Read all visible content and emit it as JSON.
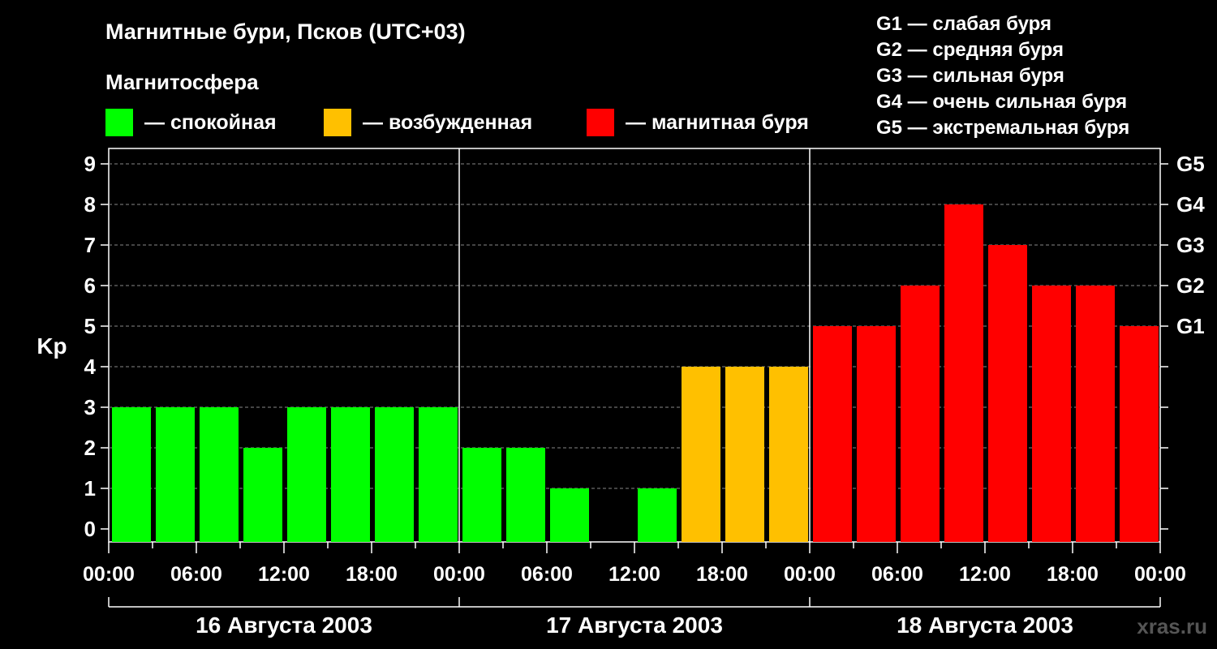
{
  "title": "Магнитные бури, Псков (UTC+03)",
  "subtitle": "Магнитосфера",
  "legend": [
    {
      "label": "— спокойная",
      "color": "#00ff00"
    },
    {
      "label": "— возбужденная",
      "color": "#ffc000"
    },
    {
      "label": "— магнитная буря",
      "color": "#ff0000"
    }
  ],
  "g_legend": [
    "G1 — слабая буря",
    "G2 — средняя буря",
    "G3 — сильная буря",
    "G4 — очень сильная буря",
    "G5 — экстремальная буря"
  ],
  "watermark": "xras.ru",
  "chart_data": {
    "type": "bar",
    "ylabel": "Kp",
    "ylim": [
      0,
      9
    ],
    "yticks": [
      0,
      1,
      2,
      3,
      4,
      5,
      6,
      7,
      8,
      9
    ],
    "g_ticks": [
      {
        "value": 5,
        "label": "G1"
      },
      {
        "value": 6,
        "label": "G2"
      },
      {
        "value": 7,
        "label": "G3"
      },
      {
        "value": 8,
        "label": "G4"
      },
      {
        "value": 9,
        "label": "G5"
      }
    ],
    "x_tick_labels": [
      "00:00",
      "06:00",
      "12:00",
      "18:00",
      "00:00",
      "06:00",
      "12:00",
      "18:00",
      "00:00",
      "06:00",
      "12:00",
      "18:00",
      "00:00"
    ],
    "days": [
      "16 Августа 2003",
      "17 Августа 2003",
      "18 Августа 2003"
    ],
    "interval_hours": 3,
    "values": [
      3,
      3,
      3,
      2,
      3,
      3,
      3,
      3,
      2,
      2,
      1,
      0,
      1,
      4,
      4,
      4,
      5,
      5,
      6,
      8,
      7,
      6,
      6,
      5
    ],
    "colors": {
      "quiet": "#00ff00",
      "active": "#ffc000",
      "storm": "#ff0000"
    },
    "grid": true
  }
}
